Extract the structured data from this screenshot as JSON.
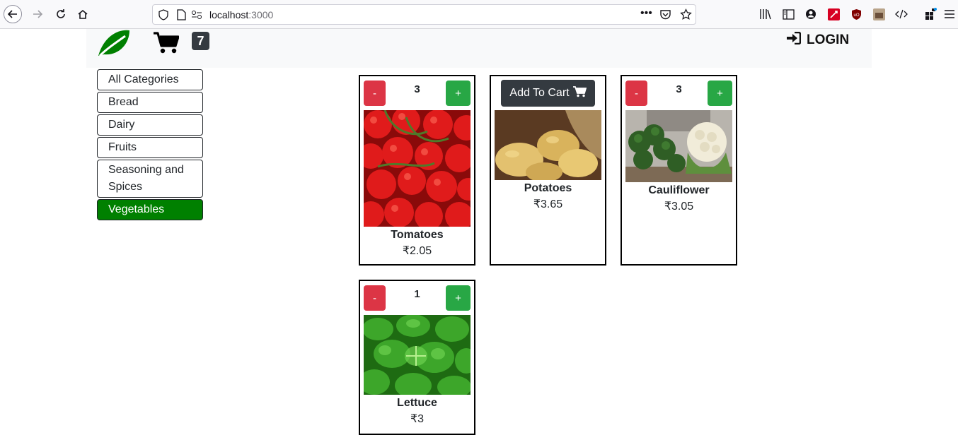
{
  "browser": {
    "url_host": "localhost",
    "url_port": ":3000"
  },
  "header": {
    "cart_count": "7",
    "login_label": "LOGIN"
  },
  "categories": [
    {
      "label": "All Categories",
      "active": false
    },
    {
      "label": "Bread",
      "active": false
    },
    {
      "label": "Dairy",
      "active": false
    },
    {
      "label": "Fruits",
      "active": false
    },
    {
      "label": "Seasoning and Spices",
      "active": false
    },
    {
      "label": "Vegetables",
      "active": true
    }
  ],
  "products": [
    {
      "name": "Tomatoes",
      "price": "₹2.05",
      "quantity": "3",
      "minus_label": "-",
      "plus_label": "+"
    },
    {
      "name": "Potatoes",
      "price": "₹3.65",
      "add_label": "Add To Cart"
    },
    {
      "name": "Cauliflower",
      "price": "₹3.05",
      "quantity": "3",
      "minus_label": "-",
      "plus_label": "+"
    },
    {
      "name": "Lettuce",
      "price": "₹3",
      "quantity": "1",
      "minus_label": "-",
      "plus_label": "+"
    }
  ],
  "colors": {
    "active_category": "#008000",
    "minus_button": "#dc3545",
    "plus_button": "#28a745",
    "dark_button": "#343a40"
  }
}
